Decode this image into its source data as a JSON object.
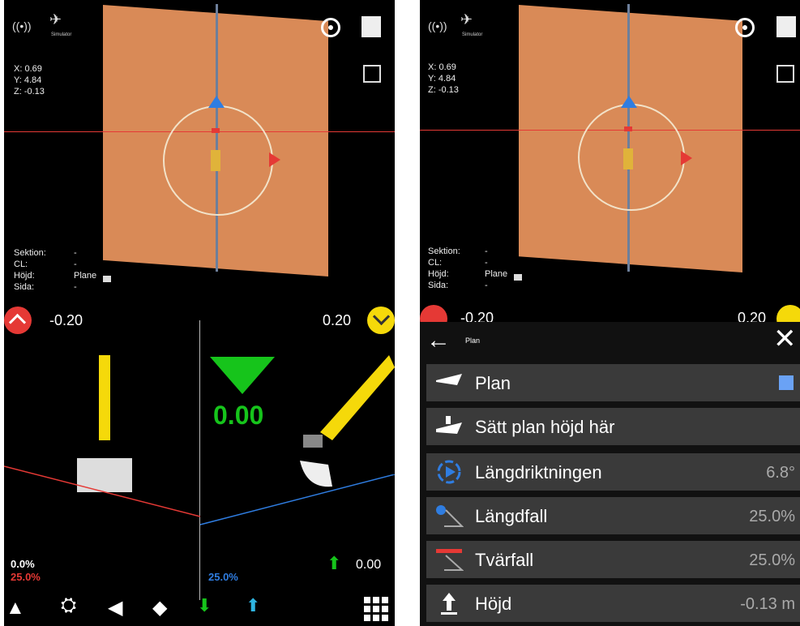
{
  "left": {
    "status": {
      "simulator_label": "Simulator"
    },
    "coords": {
      "x": "X: 0.69",
      "y": "Y: 4.84",
      "z": "Z: -0.13"
    },
    "info": {
      "sektion_label": "Sektion:",
      "sektion_value": "-",
      "cl_label": "CL:",
      "cl_value": "-",
      "hojd_label": "Höjd:",
      "hojd_value": "Plane",
      "sida_label": "Sida:",
      "sida_value": "-"
    },
    "offset_left": "-0.20",
    "offset_right": "0.20",
    "cut_value": "0.00",
    "grade_left_top": "0.0%",
    "grade_left_bottom": "25.0%",
    "grade_right": "25.0%",
    "height_value": "0.00"
  },
  "right": {
    "status": {
      "simulator_label": "Simulator"
    },
    "coords": {
      "x": "X: 0.69",
      "y": "Y: 4.84",
      "z": "Z: -0.13"
    },
    "info": {
      "sektion_label": "Sektion:",
      "sektion_value": "-",
      "cl_label": "CL:",
      "cl_value": "-",
      "hojd_label": "Höjd:",
      "hojd_value": "Plane",
      "sida_label": "Sida:",
      "sida_value": "-"
    },
    "offset_left": "-0.20",
    "offset_right": "0.20",
    "menu": {
      "title": "Plan",
      "items": [
        {
          "label": "Plan",
          "value": ""
        },
        {
          "label": "Sätt plan höjd här",
          "value": ""
        },
        {
          "label": "Längdriktningen",
          "value": "6.8°"
        },
        {
          "label": "Längdfall",
          "value": "25.0%"
        },
        {
          "label": "Tvärfall",
          "value": "25.0%"
        },
        {
          "label": "Höjd",
          "value": "-0.13 m"
        }
      ]
    }
  },
  "colors": {
    "plane": "#d98a57",
    "accent_yellow": "#f5d90a",
    "accent_green": "#16c41b",
    "accent_red": "#e53935",
    "accent_blue": "#2f7de1"
  }
}
